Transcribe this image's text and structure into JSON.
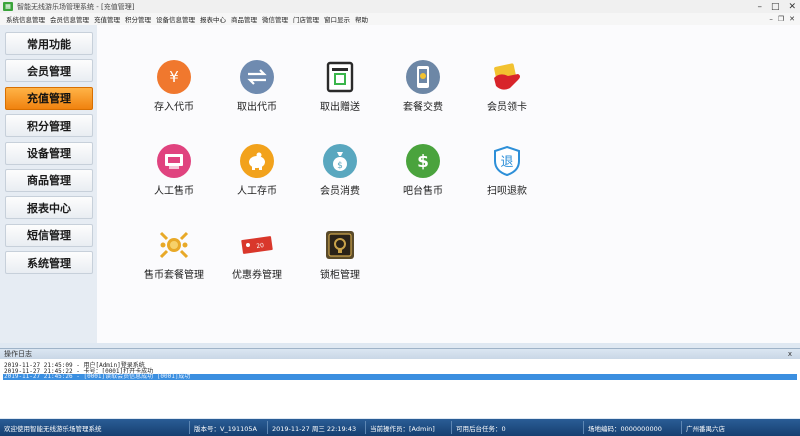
{
  "window": {
    "title": "智能无线游乐场管理系统 - [充值管理]",
    "controls": [
      "–",
      "□",
      "✕"
    ]
  },
  "menubar": {
    "items": [
      "系统信息管理",
      "会员信息管理",
      "充值管理",
      "积分管理",
      "设备信息管理",
      "报表中心",
      "商品管理",
      "微信管理",
      "门店管理",
      "窗口显示",
      "帮助"
    ],
    "mdi_controls": [
      "–",
      "❐",
      "✕"
    ]
  },
  "sidebar": {
    "items": [
      {
        "label": "常用功能",
        "active": false
      },
      {
        "label": "会员管理",
        "active": false
      },
      {
        "label": "充值管理",
        "active": true
      },
      {
        "label": "积分管理",
        "active": false
      },
      {
        "label": "设备管理",
        "active": false
      },
      {
        "label": "商品管理",
        "active": false
      },
      {
        "label": "报表中心",
        "active": false
      },
      {
        "label": "短信管理",
        "active": false
      },
      {
        "label": "系统管理",
        "active": false
      }
    ]
  },
  "functions": [
    {
      "label": "存入代币",
      "icon": "yen-coin-icon",
      "color": "#f0782e"
    },
    {
      "label": "取出代币",
      "icon": "transfer-arrows-icon",
      "color": "#6f8bb0"
    },
    {
      "label": "取出赠送",
      "icon": "atm-machine-icon",
      "color": "#2a2a2a"
    },
    {
      "label": "套餐交费",
      "icon": "phone-payment-icon",
      "color": "#6d87a6"
    },
    {
      "label": "会员领卡",
      "icon": "member-card-icon",
      "color": "#d8242a"
    },
    {
      "label": "人工售币",
      "icon": "manual-sell-icon",
      "color": "#e0437f"
    },
    {
      "label": "人工存币",
      "icon": "piggy-bank-icon",
      "color": "#f2a21c"
    },
    {
      "label": "会员消费",
      "icon": "money-bag-icon",
      "color": "#59a7bf"
    },
    {
      "label": "吧台售币",
      "icon": "dollar-coin-icon",
      "color": "#4aa33d"
    },
    {
      "label": "扫呗退款",
      "icon": "refund-shield-icon",
      "color": "#2d8fd8"
    },
    {
      "label": "售币套餐管理",
      "icon": "coin-package-icon",
      "color": "#e8a928"
    },
    {
      "label": "优惠券管理",
      "icon": "coupon-icon",
      "color": "#d9372b"
    },
    {
      "label": "锁柜管理",
      "icon": "locker-icon",
      "color": "#5a4a2a"
    }
  ],
  "log": {
    "title": "操作日志",
    "close": "x",
    "lines": [
      {
        "text": "2019-11-27 21:45:09 - 用户[Admin]登录系统",
        "selected": false
      },
      {
        "text": "2019-11-27 21:45:22 - 卡号：[0001]打开卡成功",
        "selected": false
      },
      {
        "text": "2019-11-27 21:45:26 - [0001]读取会员信息成功   [0001]成功",
        "selected": true
      }
    ]
  },
  "statusbar": {
    "welcome": "欢迎使用智能无线游乐场管理系统",
    "version": "版本号：V_191105A",
    "datetime": "2019-11-27 周三 22:19:43",
    "operator": "当前操作员：[Admin]",
    "tasks": "可用后台任务：0",
    "site_code": "场地编码：0000000000",
    "store": "广州番禺六店"
  },
  "colors": {
    "accent_active": "#f0820f",
    "statusbar": "#1f4f86",
    "log_selected": "#3b8fe0"
  }
}
